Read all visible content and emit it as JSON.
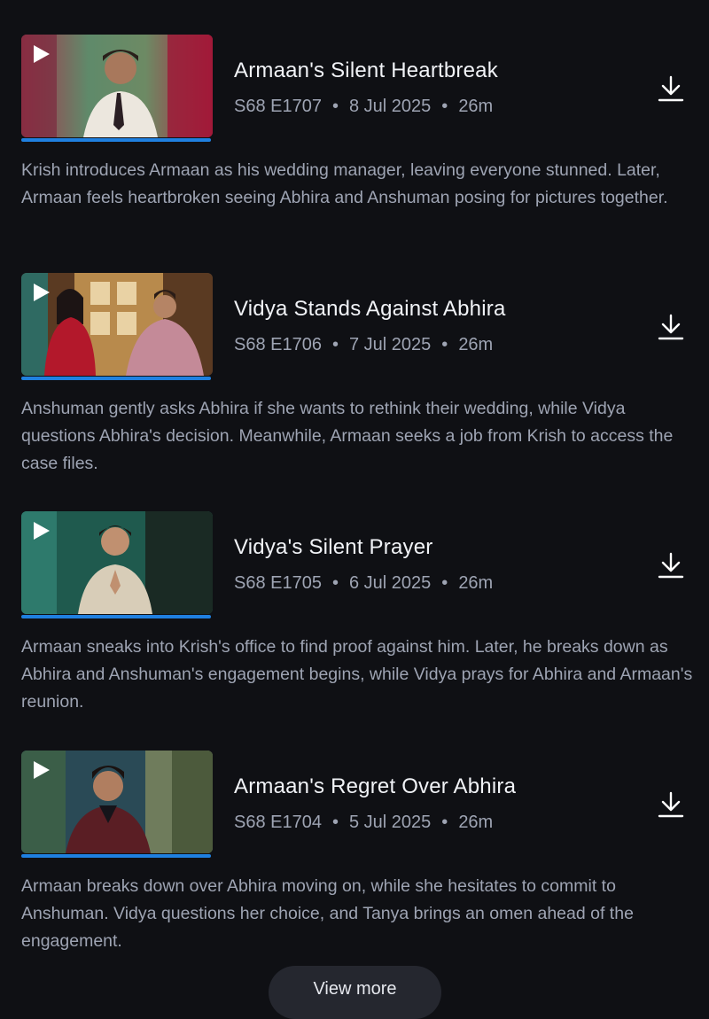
{
  "episodes": [
    {
      "title": "Armaan's Silent Heartbreak",
      "season_episode": "S68 E1707",
      "date": "8 Jul 2025",
      "duration": "26m",
      "progress": 1.0,
      "description": "Krish introduces Armaan as his wedding manager, leaving everyone stunned. Later, Armaan feels heartbroken seeing Abhira and Anshuman posing for pictures together."
    },
    {
      "title": "Vidya Stands Against Abhira",
      "season_episode": "S68 E1706",
      "date": "7 Jul 2025",
      "duration": "26m",
      "progress": 1.0,
      "description": "Anshuman gently asks Abhira if she wants to rethink their wedding, while Vidya questions Abhira's decision. Meanwhile, Armaan seeks a job from Krish to access the case files."
    },
    {
      "title": "Vidya's Silent Prayer",
      "season_episode": "S68 E1705",
      "date": "6 Jul 2025",
      "duration": "26m",
      "progress": 1.0,
      "description": "Armaan sneaks into Krish's office to find proof against him. Later, he breaks down as Abhira and Anshuman's engagement begins, while Vidya prays for Abhira and Armaan's reunion."
    },
    {
      "title": "Armaan's Regret Over Abhira",
      "season_episode": "S68 E1704",
      "date": "5 Jul 2025",
      "duration": "26m",
      "progress": 1.0,
      "description": "Armaan breaks down over Abhira moving on, while she hesitates to commit to Anshuman. Vidya questions her choice, and Tanya brings an omen ahead of the engagement."
    }
  ],
  "view_more_label": "View more",
  "icons": {
    "play": "play-icon",
    "download": "download-icon"
  },
  "colors": {
    "background": "#0f1014",
    "progress": "#1f80e0"
  }
}
